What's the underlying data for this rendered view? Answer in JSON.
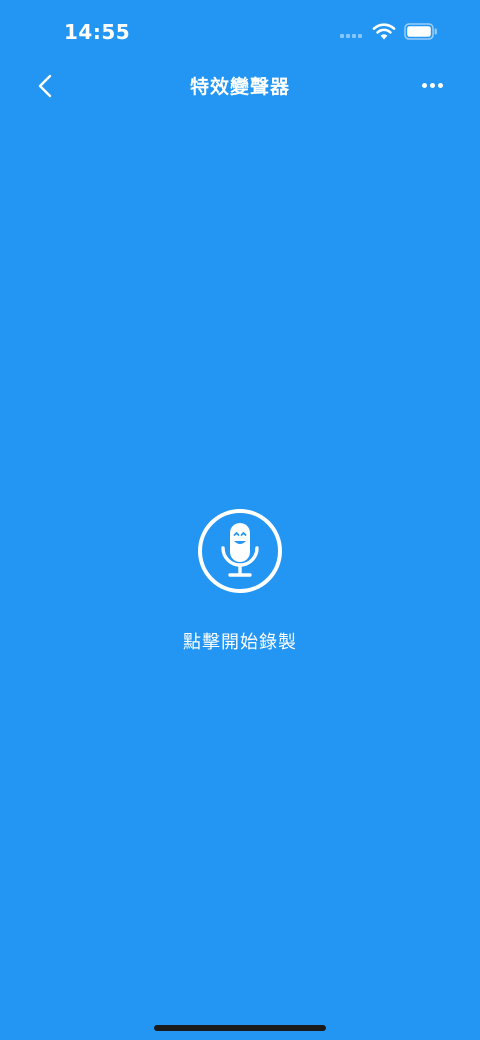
{
  "status_bar": {
    "time": "14:55",
    "icons": [
      "signal-dots",
      "wifi-icon",
      "battery-icon"
    ]
  },
  "nav": {
    "title": "特效變聲器",
    "back_icon": "chevron-left-icon",
    "more_icon": "ellipsis-icon"
  },
  "record": {
    "icon": "microphone-icon",
    "label": "點擊開始錄製"
  },
  "colors": {
    "background": "#2396f3",
    "foreground": "#ffffff",
    "home_indicator": "#1a1a1a"
  }
}
